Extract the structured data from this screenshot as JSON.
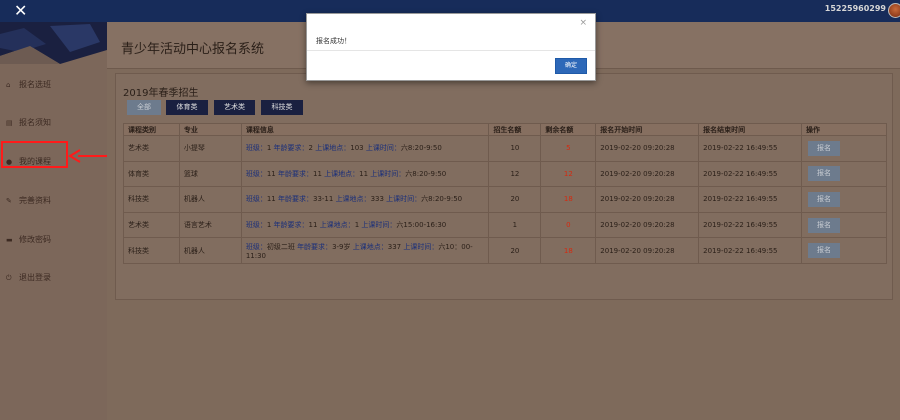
{
  "topbar": {
    "close_icon": "close-icon",
    "phone": "15225960299",
    "avatar_icon": "user-avatar"
  },
  "app": {
    "title": "青少年活动中心报名系统"
  },
  "sidebar": {
    "items": [
      {
        "label": "报名选班",
        "icon": "home-icon",
        "glyph": "⌂"
      },
      {
        "label": "报名须知",
        "icon": "document-icon",
        "glyph": "▤"
      },
      {
        "label": "我的课程",
        "icon": "user-icon",
        "glyph": "●"
      },
      {
        "label": "完善资料",
        "icon": "edit-icon",
        "glyph": "✎"
      },
      {
        "label": "修改密码",
        "icon": "lock-icon",
        "glyph": "▬"
      },
      {
        "label": "退出登录",
        "icon": "power-icon",
        "glyph": "⏻"
      }
    ]
  },
  "main": {
    "season": "2019年春季招生",
    "filters": [
      "全部",
      "体育类",
      "艺术类",
      "科技类"
    ],
    "table": {
      "headers": [
        "课程类别",
        "专业",
        "课程信息",
        "招生名额",
        "剩余名额",
        "报名开始时间",
        "报名结束时间",
        "操作"
      ],
      "rows": [
        {
          "category": "艺术类",
          "major": "小提琴",
          "info": [
            [
              "班级：",
              "1"
            ],
            [
              "年龄要求：",
              "2"
            ],
            [
              "上课地点：",
              "103"
            ],
            [
              "上课时间：",
              "六8:20-9:50"
            ]
          ],
          "quota": "10",
          "remaining": "5",
          "start": "2019-02-20 09:20:28",
          "end": "2019-02-22 16:49:55",
          "action": "报名"
        },
        {
          "category": "体育类",
          "major": "篮球",
          "info": [
            [
              "班级：",
              "11"
            ],
            [
              "年龄要求：",
              "11"
            ],
            [
              "上课地点：",
              "11"
            ],
            [
              "上课时间：",
              "六8:20-9:50"
            ]
          ],
          "quota": "12",
          "remaining": "12",
          "start": "2019-02-20 09:20:28",
          "end": "2019-02-22 16:49:55",
          "action": "报名"
        },
        {
          "category": "科技类",
          "major": "机器人",
          "info": [
            [
              "班级：",
              "11"
            ],
            [
              "年龄要求：",
              "33-11"
            ],
            [
              "上课地点：",
              "333"
            ],
            [
              "上课时间：",
              "六8:20-9:50"
            ]
          ],
          "quota": "20",
          "remaining": "18",
          "start": "2019-02-20 09:20:28",
          "end": "2019-02-22 16:49:55",
          "action": "报名"
        },
        {
          "category": "艺术类",
          "major": "语言艺术",
          "info": [
            [
              "班级：",
              "1"
            ],
            [
              "年龄要求：",
              "11"
            ],
            [
              "上课地点：",
              "1"
            ],
            [
              "上课时间：",
              "六15:00-16:30"
            ]
          ],
          "quota": "1",
          "remaining": "0",
          "start": "2019-02-20 09:20:28",
          "end": "2019-02-22 16:49:55",
          "action": "报名"
        },
        {
          "category": "科技类",
          "major": "机器人",
          "info": [
            [
              "班级：",
              "初级二班"
            ],
            [
              "年龄要求：",
              "3-9岁"
            ],
            [
              "上课地点：",
              "337"
            ],
            [
              "上课时间：",
              "六10：00-11:30"
            ]
          ],
          "quota": "20",
          "remaining": "18",
          "start": "2019-02-20 09:20:28",
          "end": "2019-02-22 16:49:55",
          "action": "报名"
        }
      ]
    }
  },
  "modal": {
    "message": "报名成功！",
    "ok_label": "确定",
    "close_glyph": "×"
  },
  "colors": {
    "topbar": "#172c5a",
    "highlight": "#ff1a1a",
    "remaining_red": "#d42a10",
    "ok_button": "#2d68b8"
  }
}
